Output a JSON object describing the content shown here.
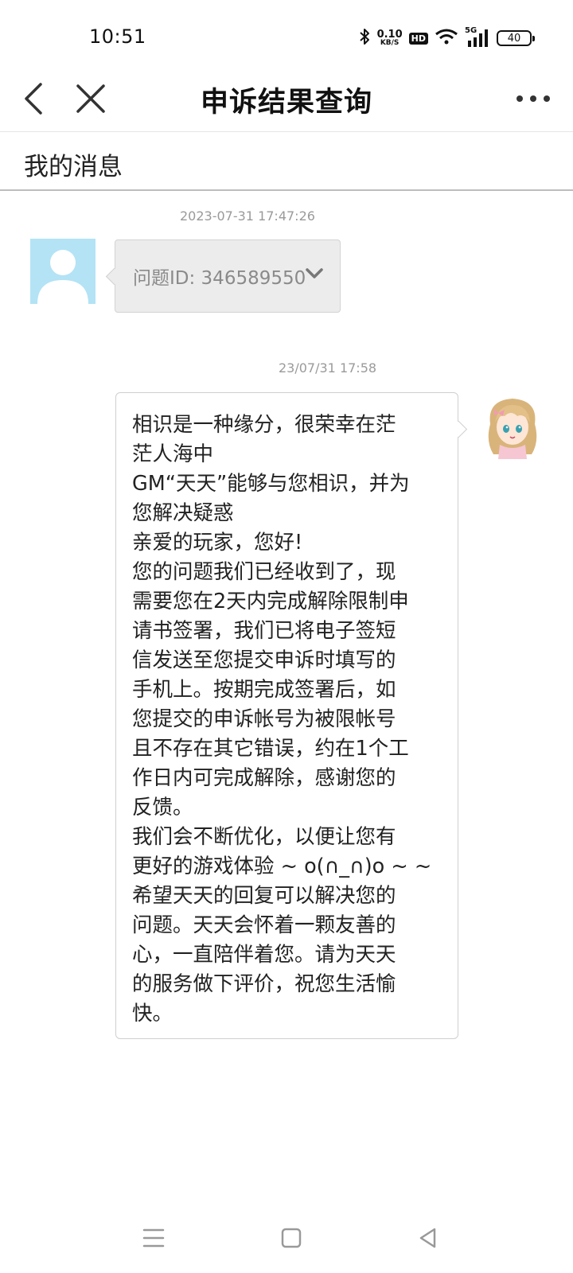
{
  "status_bar": {
    "time": "10:51",
    "net_speed_value": "0.10",
    "net_speed_unit": "KB/S",
    "hd_label": "HD",
    "network_label": "5G",
    "battery": "40",
    "icons": [
      "bluetooth-icon",
      "wifi-icon",
      "signal-icon",
      "battery-icon"
    ]
  },
  "header": {
    "title": "申诉结果查询",
    "back_icon": "chevron-left-icon",
    "close_icon": "close-icon",
    "more_icon": "more-icon"
  },
  "section": {
    "title": "我的消息"
  },
  "messages": [
    {
      "timestamp": "2023-07-31 17:47:26",
      "side": "left",
      "text": "问题ID: 346589550",
      "icon": "chevron-down-icon"
    },
    {
      "timestamp": "23/07/31 17:58",
      "side": "right",
      "lines": [
        "相识是一种缘分，很荣幸在茫",
        "茫人海中",
        "GM“天天”能够与您相识，并为",
        "您解决疑惑",
        "亲爱的玩家，您好!",
        "您的问题我们已经收到了，现",
        "需要您在2天内完成解除限制申",
        "请书签署，我们已将电子签短",
        "信发送至您提交申诉时填写的",
        "手机上。按期完成签署后，如",
        "您提交的申诉帐号为被限帐号",
        "且不存在其它错误，约在1个工",
        "作日内可完成解除，感谢您的",
        "反馈。",
        "我们会不断优化，以便让您有",
        "更好的游戏体验 ~ o(∩_∩)o ~ ~",
        "希望天天的回复可以解决您的",
        "问题。天天会怀着一颗友善的",
        "心，一直陪伴着您。请为天天",
        "的服务做下评价，祝您生活愉",
        "快。"
      ]
    }
  ],
  "colors": {
    "avatar_bg": "#b3e3f5",
    "left_bubble_bg": "#ececec",
    "timestamp": "#9a9a9a"
  },
  "bottom_nav": {
    "icons": [
      "menu-icon",
      "home-icon",
      "back-triangle-icon"
    ]
  }
}
